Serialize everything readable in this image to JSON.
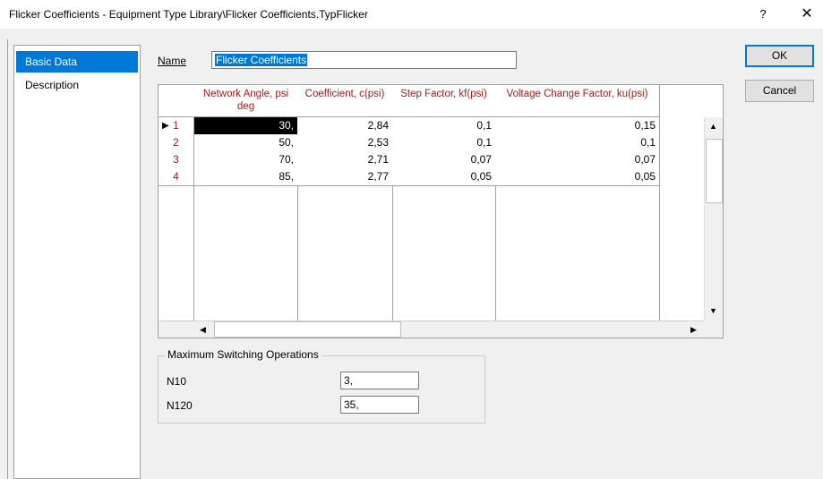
{
  "window": {
    "title": "Flicker Coefficients - Equipment Type Library\\Flicker Coefficients.TypFlicker",
    "help_glyph": "?",
    "close_glyph": "✕"
  },
  "nav": {
    "items": [
      {
        "label": "Basic Data",
        "selected": true
      },
      {
        "label": "Description",
        "selected": false
      }
    ]
  },
  "name_field": {
    "label": "Name",
    "value": "Flicker Coefficients"
  },
  "buttons": {
    "ok": "OK",
    "cancel": "Cancel"
  },
  "table": {
    "columns": [
      "Network Angle, psi deg",
      "Coefficient, c(psi)",
      "Step Factor, kf(psi)",
      "Voltage Change Factor, ku(psi)"
    ],
    "rows": [
      {
        "num": "1",
        "cells": [
          "30,",
          "2,84",
          "0,1",
          "0,15"
        ]
      },
      {
        "num": "2",
        "cells": [
          "50,",
          "2,53",
          "0,1",
          "0,1"
        ]
      },
      {
        "num": "3",
        "cells": [
          "70,",
          "2,71",
          "0,07",
          "0,07"
        ]
      },
      {
        "num": "4",
        "cells": [
          "85,",
          "2,77",
          "0,05",
          "0,05"
        ]
      }
    ],
    "current_row_marker": "▶"
  },
  "switching": {
    "title": "Maximum Switching Operations",
    "n10_label": "N10",
    "n10_value": "3,",
    "n120_label": "N120",
    "n120_value": "35,"
  },
  "icons": {
    "up": "▲",
    "down": "▼",
    "left": "◀",
    "right": "▶"
  }
}
